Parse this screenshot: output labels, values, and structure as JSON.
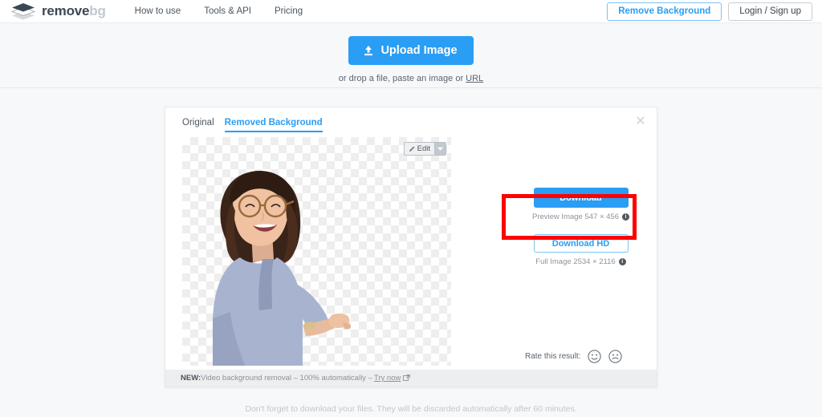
{
  "header": {
    "logo": {
      "part1": "remove",
      "part2": "bg",
      "icon": "layers-diamond-icon"
    },
    "nav": [
      {
        "label": "How to use"
      },
      {
        "label": "Tools & API"
      },
      {
        "label": "Pricing"
      }
    ],
    "remove_background_button": "Remove Background",
    "login_button": "Login / Sign up"
  },
  "upload": {
    "button_label": "Upload Image",
    "button_icon": "upload-icon",
    "hint_prefix": "or drop a file, paste an image or ",
    "hint_link": "URL"
  },
  "card": {
    "tabs": [
      {
        "label": "Original",
        "active": false
      },
      {
        "label": "Removed Background",
        "active": true
      }
    ],
    "close_icon": "close-icon",
    "edit_button": {
      "label": "Edit",
      "icon": "pencil-icon",
      "caret_icon": "chevron-down-icon"
    },
    "download": {
      "label": "Download",
      "meta": "Preview Image 547 × 456",
      "info_icon": "info-icon"
    },
    "download_hd": {
      "label": "Download HD",
      "meta": "Full Image 2534 × 2116",
      "info_icon": "info-icon"
    },
    "rate": {
      "label": "Rate this result:",
      "positive_icon": "smiley-happy-icon",
      "negative_icon": "smiley-sad-icon"
    },
    "footer": {
      "badge": "NEW:",
      "text": " Video background removal – 100% automatically –",
      "link": "Try now",
      "link_icon": "external-link-icon"
    }
  },
  "page_footer": {
    "text": "Don't forget to download your files. They will be discarded automatically after 60 minutes."
  },
  "colors": {
    "accent_blue": "#2a9df4",
    "annotation_red": "#ff0000",
    "page_bg": "#f7f8f9",
    "logo_dark": "#3b4754",
    "logo_light": "#c3c9cf"
  }
}
